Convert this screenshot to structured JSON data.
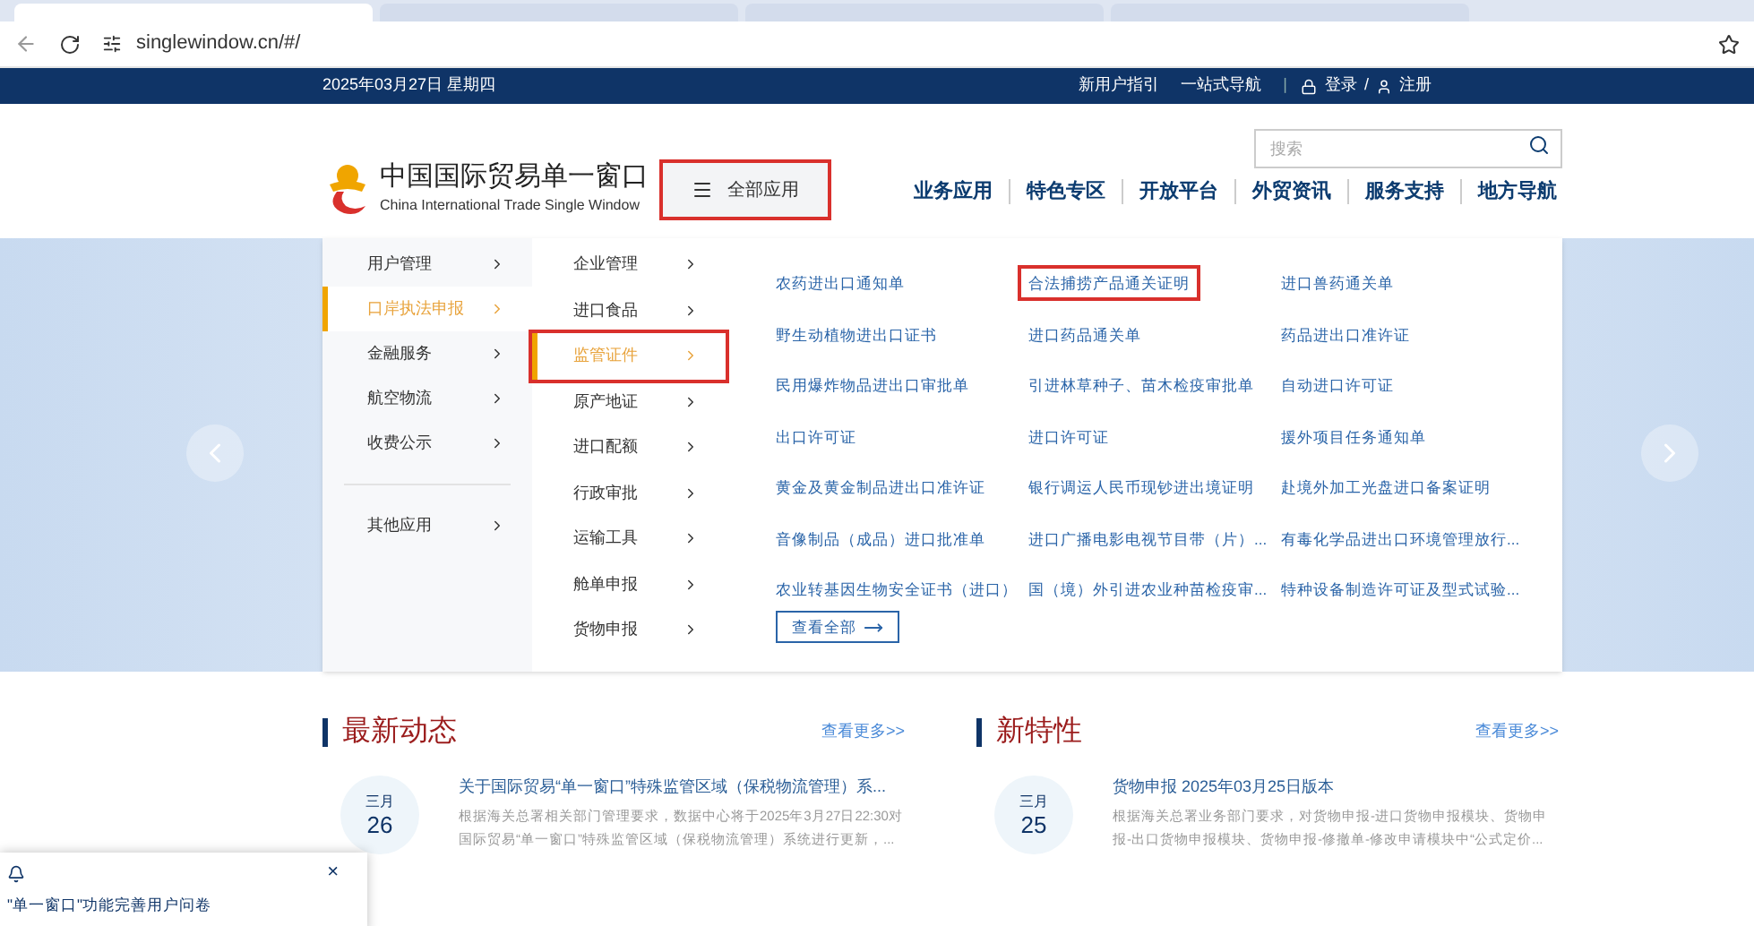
{
  "browser": {
    "url": "singlewindow.cn/#/",
    "tabs": [
      {
        "selected": true
      },
      {
        "selected": false
      },
      {
        "selected": false
      },
      {
        "selected": false
      }
    ]
  },
  "top_bar": {
    "date": "2025年03月27日 星期四",
    "links": [
      "新用户指引",
      "一站式导航"
    ],
    "divider": "|",
    "login": "登录",
    "separator": "/",
    "register": "注册"
  },
  "header": {
    "logo_title": "中国国际贸易单一窗口",
    "logo_subtitle": "China International Trade Single Window",
    "all_apps": {
      "label": "全部应用",
      "annotated": true
    },
    "search": {
      "placeholder": "搜索"
    },
    "nav": [
      "业务应用",
      "特色专区",
      "开放平台",
      "外贸资讯",
      "服务支持",
      "地方导航"
    ]
  },
  "menu": {
    "level1": [
      {
        "label": "用户管理",
        "selected": false
      },
      {
        "label": "口岸执法申报",
        "selected": true
      },
      {
        "label": "金融服务",
        "selected": false
      },
      {
        "label": "航空物流",
        "selected": false
      },
      {
        "label": "收费公示",
        "selected": false
      },
      {
        "label": "其他应用",
        "selected": false,
        "kind": "separated"
      }
    ],
    "level2": [
      {
        "label": "企业管理",
        "selected": false,
        "annotated": false
      },
      {
        "label": "进口食品",
        "selected": false,
        "annotated": false
      },
      {
        "label": "监管证件",
        "selected": true,
        "annotated": true
      },
      {
        "label": "原产地证",
        "selected": false,
        "annotated": false
      },
      {
        "label": "进口配额",
        "selected": false,
        "annotated": false
      },
      {
        "label": "行政审批",
        "selected": false,
        "annotated": false
      },
      {
        "label": "运输工具",
        "selected": false,
        "annotated": false
      },
      {
        "label": "舱单申报",
        "selected": false,
        "annotated": false
      },
      {
        "label": "货物申报",
        "selected": false,
        "annotated": false
      }
    ],
    "items": [
      {
        "label": "农药进出口通知单",
        "annotated": false
      },
      {
        "label": "合法捕捞产品通关证明",
        "annotated": true
      },
      {
        "label": "进口兽药通关单",
        "annotated": false
      },
      {
        "label": "野生动植物进出口证书",
        "annotated": false
      },
      {
        "label": "进口药品通关单",
        "annotated": false
      },
      {
        "label": "药品进出口准许证",
        "annotated": false
      },
      {
        "label": "民用爆炸物品进出口审批单",
        "annotated": false
      },
      {
        "label": "引进林草种子、苗木检疫审批单",
        "annotated": false
      },
      {
        "label": "自动进口许可证",
        "annotated": false
      },
      {
        "label": "出口许可证",
        "annotated": false
      },
      {
        "label": "进口许可证",
        "annotated": false
      },
      {
        "label": "援外项目任务通知单",
        "annotated": false
      },
      {
        "label": "黄金及黄金制品进出口准许证",
        "annotated": false
      },
      {
        "label": "银行调运人民币现钞进出境证明",
        "annotated": false
      },
      {
        "label": "赴境外加工光盘进口备案证明",
        "annotated": false
      },
      {
        "label": "音像制品（成品）进口批准单",
        "annotated": false
      },
      {
        "label": "进口广播电影电视节目带（片）...",
        "annotated": false
      },
      {
        "label": "有毒化学品进出口环境管理放行...",
        "annotated": false
      },
      {
        "label": "农业转基因生物安全证书（进口）",
        "annotated": false
      },
      {
        "label": "国（境）外引进农业种苗检疫审...",
        "annotated": false
      },
      {
        "label": "特种设备制造许可证及型式试验...",
        "annotated": false
      }
    ],
    "view_all": "查看全部"
  },
  "news": [
    {
      "title": "最新动态",
      "more": "查看更多>>",
      "entry": {
        "month": "三月",
        "day": "26",
        "headline": "关于国际贸易“单一窗口”特殊监管区域（保税物流管理）系...",
        "summary": "根据海关总署相关部门管理要求，数据中心将于2025年3月27日22:30对国际贸易“单一窗口”特殊监管区域（保税物流管理）系统进行更新，..."
      }
    },
    {
      "title": "新特性",
      "more": "查看更多>>",
      "entry": {
        "month": "三月",
        "day": "25",
        "headline": "货物申报 2025年03月25日版本",
        "summary": "根据海关总署业务部门要求，对货物申报-进口货物申报模块、货物申报-出口货物申报模块、货物申报-修撤单-修改申请模块中“公式定价..."
      }
    }
  ],
  "popup": {
    "close": "×",
    "link": "\"单一窗口\"功能完善用户问卷"
  }
}
